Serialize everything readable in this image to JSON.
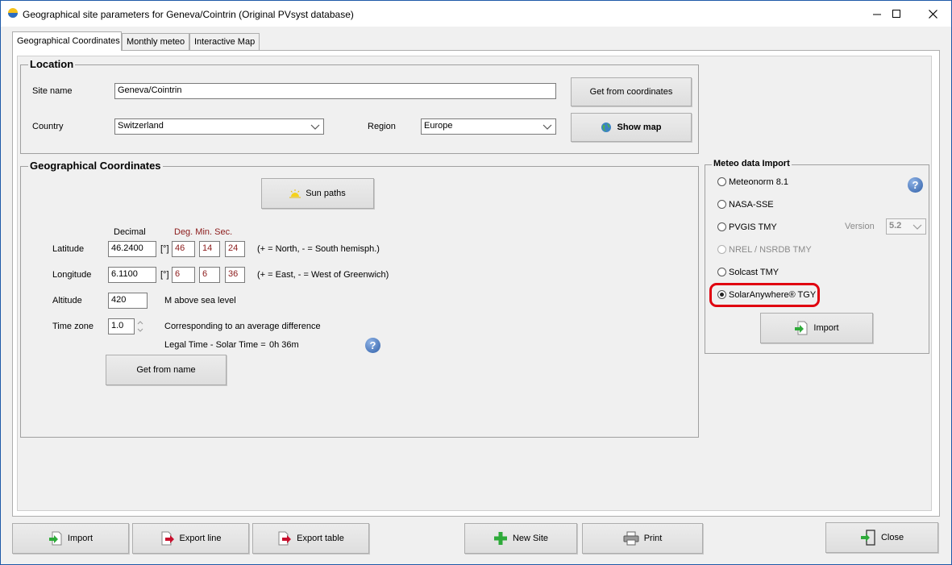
{
  "window": {
    "title": "Geographical site parameters for Geneva/Cointrin (Original PVsyst database)",
    "minimize": "—",
    "maximize": "☐",
    "close": "✕"
  },
  "tabs": [
    {
      "label": "Geographical Coordinates",
      "active": true
    },
    {
      "label": "Monthly meteo",
      "active": false
    },
    {
      "label": "Interactive Map",
      "active": false
    }
  ],
  "location": {
    "title": "Location",
    "site_name_label": "Site name",
    "site_name_value": "Geneva/Cointrin",
    "country_label": "Country",
    "country_value": "Switzerland",
    "region_label": "Region",
    "region_value": "Europe",
    "get_from_coordinates": "Get from coordinates",
    "show_map": "Show map"
  },
  "coords": {
    "title": "Geographical Coordinates",
    "sun_paths": "Sun paths",
    "decimal_header": "Decimal",
    "dms_header": "Deg. Min. Sec.",
    "latitude_label": "Latitude",
    "latitude_decimal": "46.2400",
    "latitude_unit": "[°]",
    "latitude_deg": "46",
    "latitude_min": "14",
    "latitude_sec": "24",
    "latitude_hint": "(+ = North, - = South hemisph.)",
    "longitude_label": "Longitude",
    "longitude_decimal": "6.1100",
    "longitude_unit": "[°]",
    "longitude_deg": "6",
    "longitude_min": "6",
    "longitude_sec": "36",
    "longitude_hint": "(+ = East, - = West of Greenwich)",
    "altitude_label": "Altitude",
    "altitude_value": "420",
    "altitude_unit": "M above sea level",
    "timezone_label": "Time zone",
    "timezone_value": "1.0",
    "timezone_hint": "Corresponding to an average difference",
    "legal_solar_label": "Legal Time - Solar Time =",
    "legal_solar_value": "0h 36m",
    "get_from_name": "Get from name"
  },
  "meteo": {
    "title": "Meteo data Import",
    "options": [
      {
        "label": "Meteonorm 8.1",
        "checked": false,
        "disabled": false
      },
      {
        "label": "NASA-SSE",
        "checked": false,
        "disabled": false
      },
      {
        "label": "PVGIS TMY",
        "checked": false,
        "disabled": false
      },
      {
        "label": "NREL / NSRDB TMY",
        "checked": false,
        "disabled": true
      },
      {
        "label": "Solcast TMY",
        "checked": false,
        "disabled": false
      },
      {
        "label": "SolarAnywhere® TGY",
        "checked": true,
        "disabled": false
      }
    ],
    "version_label": "Version",
    "version_value": "5.2",
    "import": "Import"
  },
  "footer": {
    "import": "Import",
    "export_line": "Export line",
    "export_table": "Export table",
    "new_site": "New Site",
    "print": "Print",
    "close": "Close"
  },
  "colors": {
    "highlight": "#e0000f",
    "accent_blue": "#2f5fa8"
  }
}
